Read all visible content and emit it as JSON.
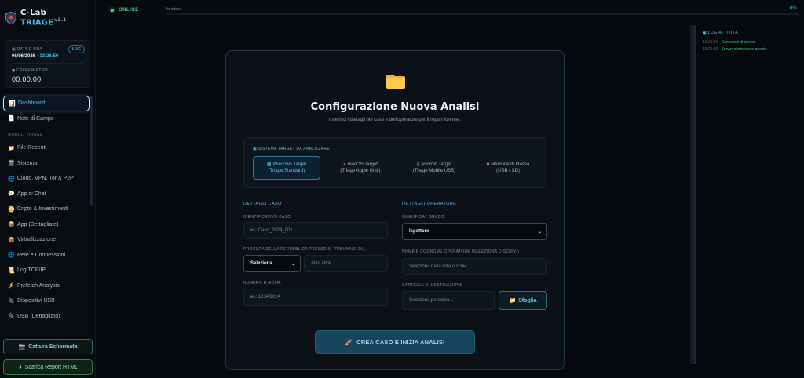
{
  "app": {
    "name_part1": "C-Lab",
    "name_part2": "TRIAGE",
    "version": "v3.1"
  },
  "status": {
    "label": "ONLINE",
    "progress_text": "In attesa",
    "progress_pct_label": "0%",
    "progress_value": 0
  },
  "clock": {
    "date_label": "DATA E ORA",
    "date": "06/06/2026 - ",
    "time": "13:26:50",
    "live": "LIVE",
    "chrono_label": "CRONOMETRO",
    "chrono_value": "00:00:00",
    "chrono_dash": "-"
  },
  "sidebar": {
    "dashboard": "Dashboard",
    "notes": "Note di Campo",
    "section": "MODULI TRIAGE",
    "modules": [
      {
        "label": "File Recenti",
        "icon": "folder-icon",
        "glyph": "📁"
      },
      {
        "label": "Sistema",
        "icon": "monitor-icon",
        "glyph": "🖥"
      },
      {
        "label": "Cloud, VPN, Tor & P2P",
        "icon": "globe-icon",
        "glyph": "🌐"
      },
      {
        "label": "App di Chat",
        "icon": "chat-icon",
        "glyph": "💬"
      },
      {
        "label": "Cripto & Investimenti",
        "icon": "coin-icon",
        "glyph": "🪙"
      },
      {
        "label": "App (Dettagliate)",
        "icon": "apps-icon",
        "glyph": "📦"
      },
      {
        "label": "Virtualizzazione",
        "icon": "box-icon",
        "glyph": "📦"
      },
      {
        "label": "Rete e Connessioni",
        "icon": "network-icon",
        "glyph": "🌐"
      },
      {
        "label": "Log TCP/IP",
        "icon": "log-icon",
        "glyph": "📜"
      },
      {
        "label": "Prefetch Analysis",
        "icon": "bolt-icon",
        "glyph": "⚡"
      },
      {
        "label": "Dispositivi USB",
        "icon": "usb-icon",
        "glyph": "🔌"
      },
      {
        "label": "USB (Dettagliato)",
        "icon": "usb-icon",
        "glyph": "🔌"
      }
    ],
    "capture_label": "Cattura Schermata",
    "report_label": "Scarica Report HTML"
  },
  "log": {
    "title": "LOG ATTIVITÀ",
    "entries": [
      {
        "time": "13:25:40",
        "text": "Connesso al server."
      },
      {
        "time": "13:25:40",
        "text": "Server connesso e pronto."
      }
    ]
  },
  "form": {
    "title": "Configurazione Nuova Analisi",
    "subtitle": "Inserisci i dettagli del caso e dell'operatore per il report forense.",
    "target_label": "SISTEMA TARGET DA ANALIZZARE",
    "targets": [
      {
        "line1": "Windows Target",
        "line2": "(Triage Standard)",
        "selected": true
      },
      {
        "line1": "macOS Target",
        "line2": "(Triage Apple Unix)",
        "selected": false
      },
      {
        "line1": "Android Target",
        "line2": "(Triage Mobile USB)",
        "selected": false
      },
      {
        "line1": "Memorie di Massa",
        "line2": "(USB / SD)",
        "selected": false
      }
    ],
    "case_section": "DETTAGLI CASO",
    "case_id_label": "IDENTIFICATIVO CASO",
    "case_id_placeholder": "es: Caso_2024_001",
    "procura_label": "PROCURA DELLA REPUBBLICA PRESSO IL TRIBUNALE DI...",
    "procura_select": "Seleziona...",
    "procura_other_placeholder": "Altra città...",
    "rgnr_label": "NUMERO R.G.N.R.",
    "rgnr_placeholder": "es: 1234/2024",
    "operator_section": "DETTAGLI OPERATORE",
    "rank_label": "QUALIFICA / GRADO",
    "rank_value": "Ispettore",
    "operator_label": "NOME E COGNOME OPERATORE (SELEZIONA O SCRIVI)",
    "operator_placeholder": "Seleziona dalla lista o scrivi...",
    "dest_label": "CARTELLA DI DESTINAZIONE",
    "dest_placeholder": "Seleziona percorso...",
    "browse_label": "Sfoglia",
    "submit_label": "CREA CASO E INIZIA ANALISI"
  }
}
